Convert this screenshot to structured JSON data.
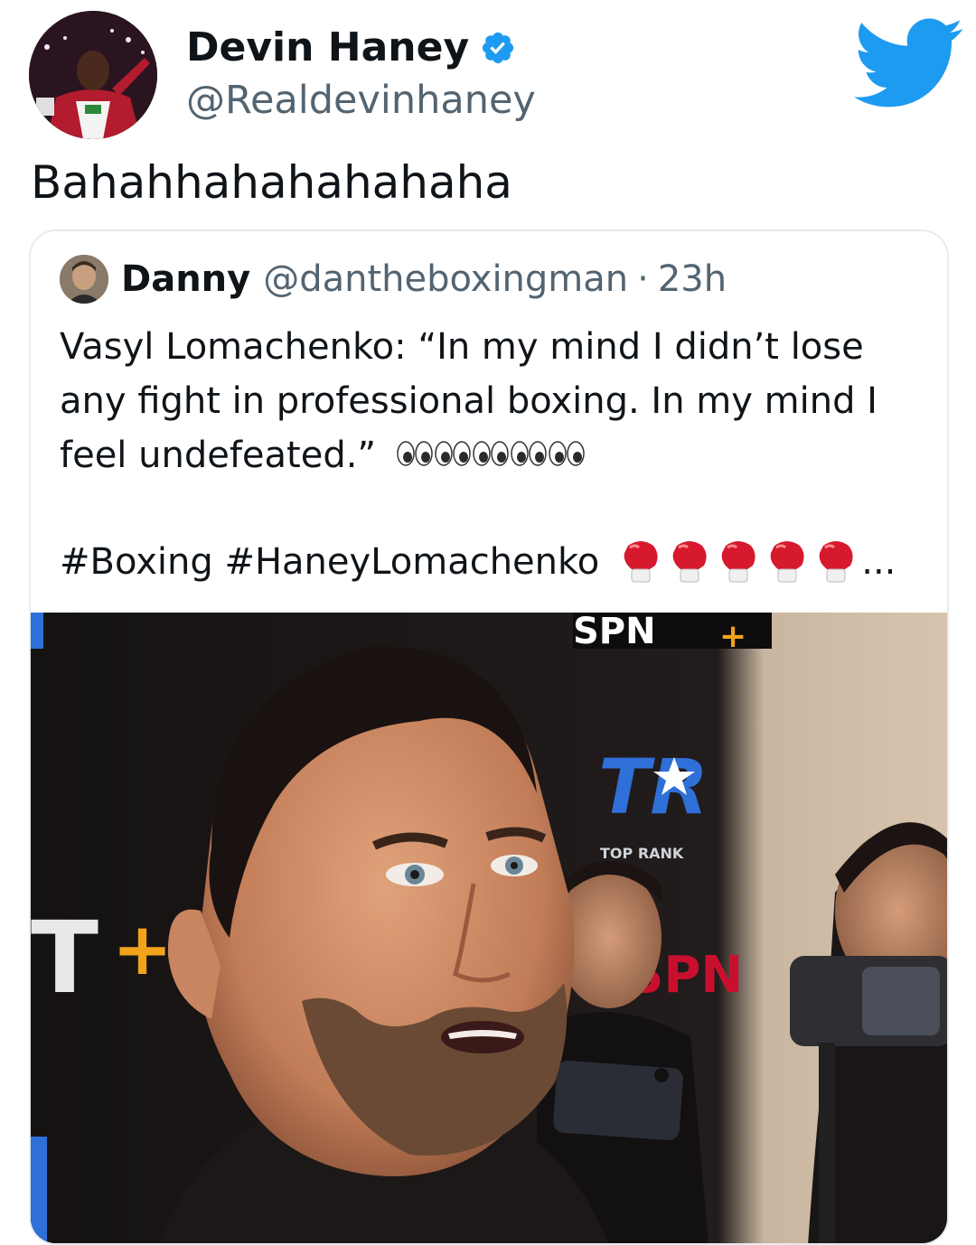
{
  "tweet": {
    "author_name": "Devin Haney",
    "author_handle": "@Realdevinhaney",
    "verified": true,
    "text": "Bahahhahahahahaha"
  },
  "quoted_tweet": {
    "author_name": "Danny",
    "author_handle": "@dantheboxingman",
    "separator": "·",
    "time": "23h",
    "text_line1": "Vasyl Lomachenko: “In my mind I didn’t lose any fight in professional boxing. In my mind I feel undefeated.”",
    "hashtags": "#Boxing #HaneyLomachenko",
    "ellipsis": "...",
    "emoji_eyes_count": 5,
    "emoji_gloves_count": 5
  },
  "icons": {
    "bird": "twitter-bird-icon",
    "verified": "verified-badge-icon",
    "eyes": "eyes-emoji-icon",
    "glove": "boxing-glove-emoji-icon"
  },
  "colors": {
    "twitter_blue": "#1d9bf0",
    "text_primary": "#0f1419",
    "text_secondary": "#536471",
    "card_border": "#e6ecf0"
  },
  "media": {
    "signage_tr": "TR",
    "signage_top_rank": "TOP RANK"
  }
}
